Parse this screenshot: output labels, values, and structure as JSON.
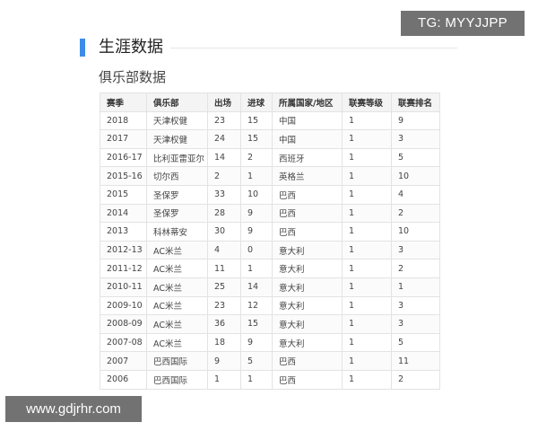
{
  "watermark_top": "TG: MYYJJPP",
  "watermark_bottom": "www.gdjrhr.com",
  "section_title": "生涯数据",
  "subsection_title": "俱乐部数据",
  "table": {
    "headers": [
      "赛季",
      "俱乐部",
      "出场",
      "进球",
      "所属国家/地区",
      "联赛等级",
      "联赛排名"
    ],
    "rows": [
      [
        "2018",
        "天津权健",
        "23",
        "15",
        "中国",
        "1",
        "9"
      ],
      [
        "2017",
        "天津权健",
        "24",
        "15",
        "中国",
        "1",
        "3"
      ],
      [
        "2016-17",
        "比利亚雷亚尔",
        "14",
        "2",
        "西班牙",
        "1",
        "5"
      ],
      [
        "2015-16",
        "切尔西",
        "2",
        "1",
        "英格兰",
        "1",
        "10"
      ],
      [
        "2015",
        "圣保罗",
        "33",
        "10",
        "巴西",
        "1",
        "4"
      ],
      [
        "2014",
        "圣保罗",
        "28",
        "9",
        "巴西",
        "1",
        "2"
      ],
      [
        "2013",
        "科林蒂安",
        "30",
        "9",
        "巴西",
        "1",
        "10"
      ],
      [
        "2012-13",
        "AC米兰",
        "4",
        "0",
        "意大利",
        "1",
        "3"
      ],
      [
        "2011-12",
        "AC米兰",
        "11",
        "1",
        "意大利",
        "1",
        "2"
      ],
      [
        "2010-11",
        "AC米兰",
        "25",
        "14",
        "意大利",
        "1",
        "1"
      ],
      [
        "2009-10",
        "AC米兰",
        "23",
        "12",
        "意大利",
        "1",
        "3"
      ],
      [
        "2008-09",
        "AC米兰",
        "36",
        "15",
        "意大利",
        "1",
        "3"
      ],
      [
        "2007-08",
        "AC米兰",
        "18",
        "9",
        "意大利",
        "1",
        "5"
      ],
      [
        "2007",
        "巴西国际",
        "9",
        "5",
        "巴西",
        "1",
        "11"
      ],
      [
        "2006",
        "巴西国际",
        "1",
        "1",
        "巴西",
        "1",
        "2"
      ]
    ]
  },
  "colors": {
    "accent": "#3e8ce8",
    "header_bg": "#f4f4f4",
    "border": "#e3e3e3"
  }
}
